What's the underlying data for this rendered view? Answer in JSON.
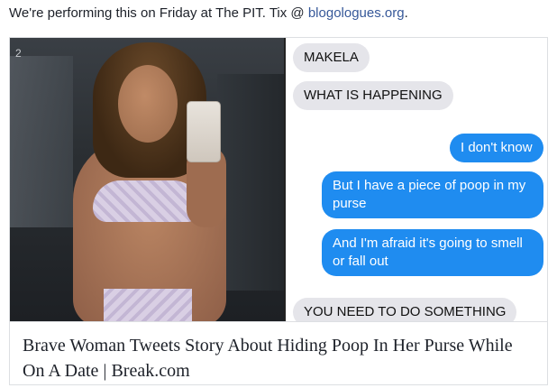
{
  "post": {
    "text": "We're performing this on Friday at The PIT. Tix @ ",
    "link_text": "blogologues.org",
    "trailing": "."
  },
  "card": {
    "image": {
      "photo_badge": "2",
      "chat": [
        {
          "text": "MAKELA",
          "side": "in"
        },
        {
          "text": "WHAT IS HAPPENING",
          "side": "in"
        },
        {
          "text": "I don't know",
          "side": "out"
        },
        {
          "text": "But I have a piece of poop in my purse",
          "side": "out"
        },
        {
          "text": "And I'm afraid it's going to smell or fall out",
          "side": "out"
        },
        {
          "text": "YOU NEED TO DO SOMETHING",
          "side": "in"
        }
      ]
    },
    "title": "Brave Woman Tweets Story About Hiding Poop In Her Purse While On A Date | Break.com"
  },
  "colors": {
    "link": "#365899",
    "bubble_out": "#1f8cf0",
    "bubble_in": "#e5e5ea"
  }
}
